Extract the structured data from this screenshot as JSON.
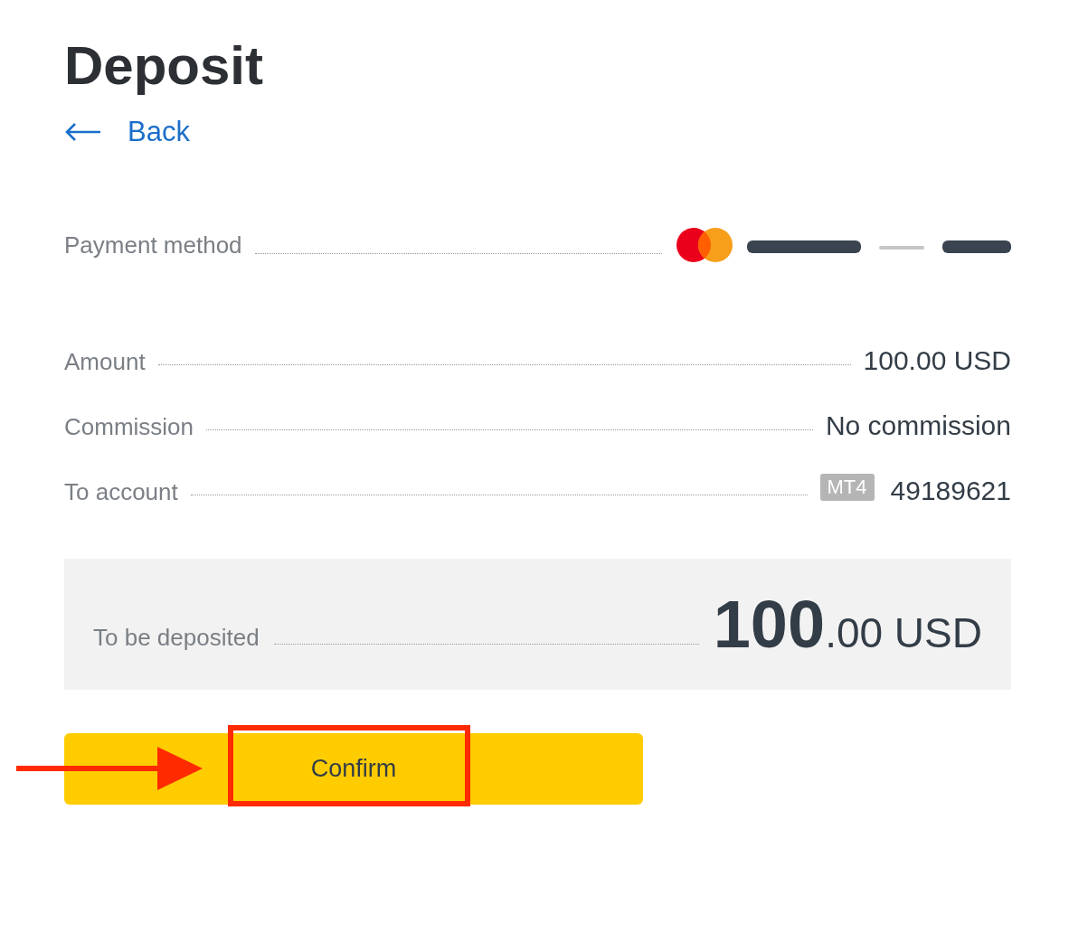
{
  "title": "Deposit",
  "back": {
    "label": "Back"
  },
  "payment_method": {
    "label": "Payment method"
  },
  "details": [
    {
      "kind": "text",
      "label": "Amount",
      "value": "100.00 USD"
    },
    {
      "kind": "text",
      "label": "Commission",
      "value": "No commission"
    },
    {
      "kind": "account",
      "label": "To account",
      "badge": "MT4",
      "value": "49189621"
    }
  ],
  "total": {
    "label": "To be deposited",
    "whole": "100",
    "fraction": ".00",
    "currency": "USD"
  },
  "confirm_button": {
    "label": "Confirm",
    "highlighted": true
  }
}
